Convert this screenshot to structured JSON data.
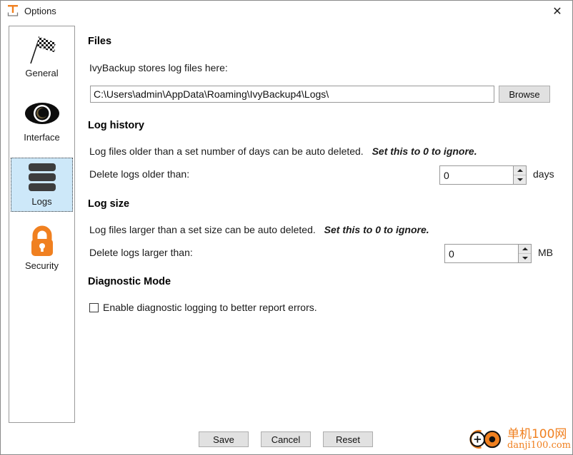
{
  "window": {
    "title": "Options",
    "icon": "ivybackup-logo-icon",
    "close_label": "✕"
  },
  "sidebar": {
    "items": [
      {
        "label": "General",
        "icon": "checkered-flag-icon",
        "selected": false
      },
      {
        "label": "Interface",
        "icon": "eye-icon",
        "selected": false
      },
      {
        "label": "Logs",
        "icon": "logs-stack-icon",
        "selected": true
      },
      {
        "label": "Security",
        "icon": "padlock-icon",
        "selected": false
      }
    ]
  },
  "main": {
    "files": {
      "heading": "Files",
      "description": "IvyBackup stores log files here:",
      "path_value": "C:\\Users\\admin\\AppData\\Roaming\\IvyBackup4\\Logs\\",
      "path_placeholder": "",
      "browse_label": "Browse"
    },
    "log_history": {
      "heading": "Log history",
      "description": "Log files older than a set number of days can be auto deleted.",
      "hint": "Set this to 0 to ignore.",
      "field_label": "Delete logs older than:",
      "value": "0",
      "unit": "days"
    },
    "log_size": {
      "heading": "Log size",
      "description": "Log files larger than a set size can be auto deleted.",
      "hint": "Set this to 0 to ignore.",
      "field_label": "Delete logs larger than:",
      "value": "0",
      "unit": "MB"
    },
    "diagnostic": {
      "heading": "Diagnostic Mode",
      "checkbox_label": "Enable diagnostic logging to better report errors.",
      "checked": false
    }
  },
  "footer": {
    "save_label": "Save",
    "cancel_label": "Cancel",
    "reset_label": "Reset"
  },
  "watermark": {
    "cn_text": "单机100网",
    "en_text": "danji100.com"
  },
  "colors": {
    "accent_orange": "#f08020",
    "selection_blue": "#cde8f9",
    "button_face": "#e1e1e1",
    "border_gray": "#999999"
  }
}
